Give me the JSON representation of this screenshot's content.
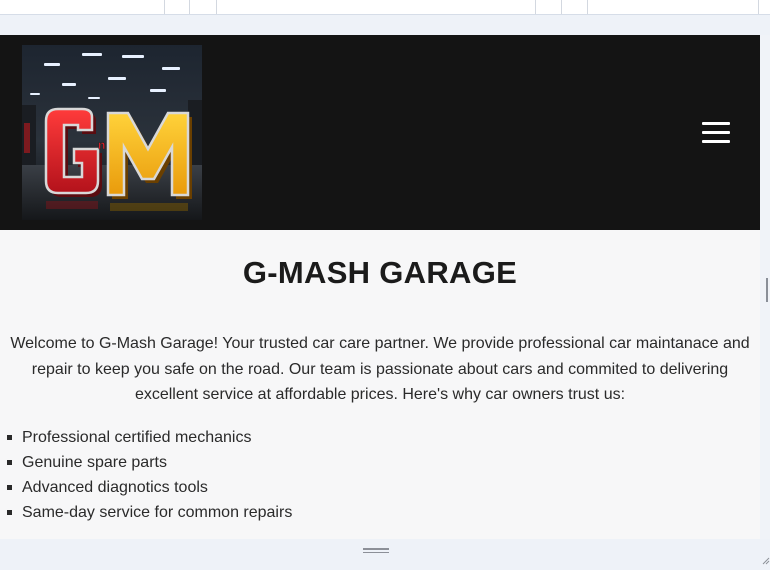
{
  "site": {
    "title": "G-MASH GARAGE",
    "intro": "Welcome to G-Mash Garage! Your trusted car care partner. We provide professional car maintanace and repair to keep you safe on the road. Our team is passionate about cars and commited to delivering excellent service at affordable prices. Here's why car owners trust us:",
    "features": [
      "Professional certified mechanics",
      "Genuine spare parts",
      "Advanced diagnotics tools",
      "Same-day service for common repairs"
    ]
  },
  "header": {
    "logo": {
      "text_g": "G",
      "text_m": "M",
      "icon": "gm-logo"
    },
    "menu_icon": "hamburger-menu-icon"
  },
  "colors": {
    "header_bg": "#141414",
    "page_bg": "#f7f7f8",
    "logo_red": "#e2202a",
    "logo_yellow": "#f5b514",
    "text": "#222222"
  }
}
